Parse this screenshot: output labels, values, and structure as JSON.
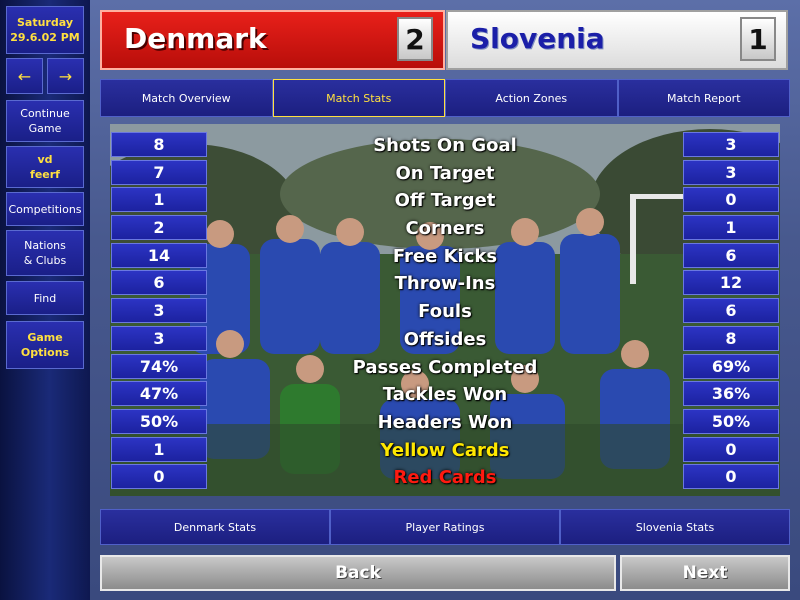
{
  "sidebar": {
    "date_day": "Saturday",
    "date": "29.6.02 PM",
    "back_arrow": "←",
    "forward_arrow": "→",
    "items": [
      {
        "label": "Continue\nGame",
        "name": "continue-game"
      },
      {
        "label": "vd\nfeerf",
        "name": "manager-name",
        "yellow": true
      },
      {
        "label": "Competitions",
        "name": "competitions"
      },
      {
        "label": "Nations\n& Clubs",
        "name": "nations-clubs"
      },
      {
        "label": "Find",
        "name": "find"
      },
      {
        "label": "Game\nOptions",
        "name": "game-options",
        "yellow": true
      }
    ]
  },
  "match": {
    "home_team": "Denmark",
    "home_score": "2",
    "away_team": "Slovenia",
    "away_score": "1"
  },
  "tabs_top": [
    "Match Overview",
    "Match Stats",
    "Action Zones",
    "Match Report"
  ],
  "active_tab": "Match Stats",
  "stats": [
    {
      "label": "Shots On Goal",
      "home": "8",
      "away": "3"
    },
    {
      "label": "On Target",
      "home": "7",
      "away": "3"
    },
    {
      "label": "Off Target",
      "home": "1",
      "away": "0"
    },
    {
      "label": "Corners",
      "home": "2",
      "away": "1"
    },
    {
      "label": "Free Kicks",
      "home": "14",
      "away": "6"
    },
    {
      "label": "Throw-Ins",
      "home": "6",
      "away": "12"
    },
    {
      "label": "Fouls",
      "home": "3",
      "away": "6"
    },
    {
      "label": "Offsides",
      "home": "3",
      "away": "8"
    },
    {
      "label": "Passes Completed",
      "home": "74%",
      "away": "69%"
    },
    {
      "label": "Tackles Won",
      "home": "47%",
      "away": "36%"
    },
    {
      "label": "Headers Won",
      "home": "50%",
      "away": "50%"
    },
    {
      "label": "Yellow Cards",
      "home": "1",
      "away": "0",
      "color": "yellow"
    },
    {
      "label": "Red Cards",
      "home": "0",
      "away": "0",
      "color": "red"
    }
  ],
  "tabs_bottom": [
    "Denmark Stats",
    "Player Ratings",
    "Slovenia Stats"
  ],
  "buttons": {
    "back": "Back",
    "next": "Next"
  },
  "colors": {
    "accent": "#ffe040",
    "home": "#d81812",
    "away_text": "#1b1fa8",
    "panel": "#1c22a0"
  }
}
